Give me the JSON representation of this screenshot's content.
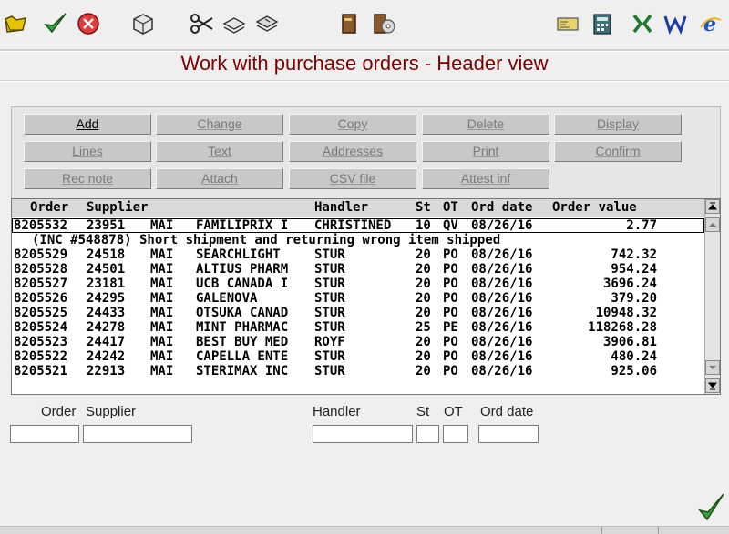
{
  "title": "Work with purchase orders - Header view",
  "toolbar": {
    "icons": [
      "folder-open-icon",
      "checkmark-icon",
      "cancel-icon",
      "package-icon",
      "scissors-icon",
      "copy-icon",
      "paste-icon",
      "book-icon",
      "book-cd-icon",
      "card-icon",
      "calculator-icon",
      "excel-icon",
      "word-icon",
      "internet-explorer-icon"
    ]
  },
  "actions": {
    "add": "Add",
    "change": "Change",
    "copy": "Copy",
    "delete": "Delete",
    "display": "Display",
    "lines": "Lines",
    "text": "Text",
    "addresses": "Addresses",
    "print": "Print",
    "confirm": "Confirm",
    "rec_note": "Rec note",
    "attach": "Attach",
    "csv_file": "CSV file",
    "attest_inf": "Attest inf"
  },
  "grid": {
    "headers": {
      "order": "Order",
      "supplier": "Supplier",
      "handler": "Handler",
      "st": "St",
      "ot": "OT",
      "ord_date": "Ord date",
      "order_value": "Order value"
    },
    "selected_note": "(INC #548878) Short shipment and returning wrong item shipped",
    "rows": [
      {
        "order": "8205532",
        "supplier": "23951",
        "code": "MAI",
        "name": "FAMILIPRIX I",
        "handler": "CHRISTINED",
        "st": "10",
        "ot": "QV",
        "date": "08/26/16",
        "value": "2.77"
      },
      {
        "order": "8205529",
        "supplier": "24518",
        "code": "MAI",
        "name": "SEARCHLIGHT",
        "handler": "STUR",
        "st": "20",
        "ot": "PO",
        "date": "08/26/16",
        "value": "742.32"
      },
      {
        "order": "8205528",
        "supplier": "24501",
        "code": "MAI",
        "name": "ALTIUS PHARM",
        "handler": "STUR",
        "st": "20",
        "ot": "PO",
        "date": "08/26/16",
        "value": "954.24"
      },
      {
        "order": "8205527",
        "supplier": "23181",
        "code": "MAI",
        "name": "UCB CANADA I",
        "handler": "STUR",
        "st": "20",
        "ot": "PO",
        "date": "08/26/16",
        "value": "3696.24"
      },
      {
        "order": "8205526",
        "supplier": "24295",
        "code": "MAI",
        "name": "GALENOVA",
        "handler": "STUR",
        "st": "20",
        "ot": "PO",
        "date": "08/26/16",
        "value": "379.20"
      },
      {
        "order": "8205525",
        "supplier": "24433",
        "code": "MAI",
        "name": "OTSUKA CANAD",
        "handler": "STUR",
        "st": "20",
        "ot": "PO",
        "date": "08/26/16",
        "value": "10948.32"
      },
      {
        "order": "8205524",
        "supplier": "24278",
        "code": "MAI",
        "name": "MINT PHARMAC",
        "handler": "STUR",
        "st": "25",
        "ot": "PE",
        "date": "08/26/16",
        "value": "118268.28"
      },
      {
        "order": "8205523",
        "supplier": "24417",
        "code": "MAI",
        "name": "BEST BUY MED",
        "handler": "ROYF",
        "st": "20",
        "ot": "PO",
        "date": "08/26/16",
        "value": "3906.81"
      },
      {
        "order": "8205522",
        "supplier": "24242",
        "code": "MAI",
        "name": "CAPELLA ENTE",
        "handler": "STUR",
        "st": "20",
        "ot": "PO",
        "date": "08/26/16",
        "value": "480.24"
      },
      {
        "order": "8205521",
        "supplier": "22913",
        "code": "MAI",
        "name": "STERIMAX INC",
        "handler": "STUR",
        "st": "20",
        "ot": "PO",
        "date": "08/26/16",
        "value": "925.06"
      }
    ]
  },
  "filters": {
    "order_label": "Order",
    "supplier_label": "Supplier",
    "handler_label": "Handler",
    "st_label": "St",
    "ot_label": "OT",
    "ord_date_label": "Ord date",
    "order_value": "",
    "supplier_value": "",
    "handler_value": "",
    "st_value": "",
    "ot_value": "",
    "ord_date_value": ""
  },
  "colors": {
    "title": "#800000",
    "enabled_text": "#000000",
    "disabled_text": "#7a7a7a"
  }
}
